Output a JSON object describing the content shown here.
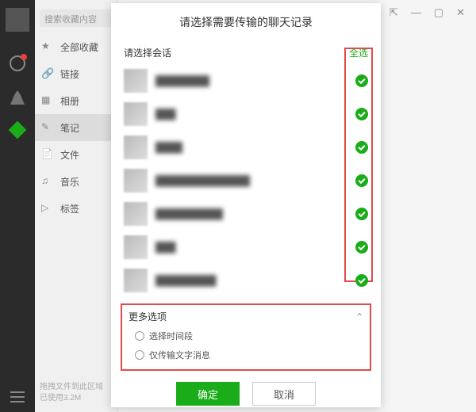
{
  "search": {
    "placeholder": "搜索收藏内容"
  },
  "nav": {
    "items": [
      {
        "label": "全部收藏"
      },
      {
        "label": "链接"
      },
      {
        "label": "相册"
      },
      {
        "label": "笔记"
      },
      {
        "label": "文件"
      },
      {
        "label": "音乐"
      },
      {
        "label": "标签"
      }
    ],
    "active_index": 3
  },
  "footer": {
    "line1": "拖拽文件到此区域",
    "line2": "已使用3.2M"
  },
  "window": {
    "pin": "⇱",
    "min": "—",
    "max": "▢",
    "close": "✕"
  },
  "modal": {
    "title": "请选择需要传输的聊天记录",
    "select_label": "请选择会话",
    "all_label": "全选",
    "chats": [
      {
        "name": "████████"
      },
      {
        "name": "███"
      },
      {
        "name": "████"
      },
      {
        "name": "██████████████"
      },
      {
        "name": "██████████"
      },
      {
        "name": "███"
      },
      {
        "name": "█████████"
      }
    ],
    "more": {
      "title": "更多选项",
      "opt1": "选择时间段",
      "opt2": "仅传输文字消息"
    },
    "ok": "确定",
    "cancel": "取消"
  }
}
